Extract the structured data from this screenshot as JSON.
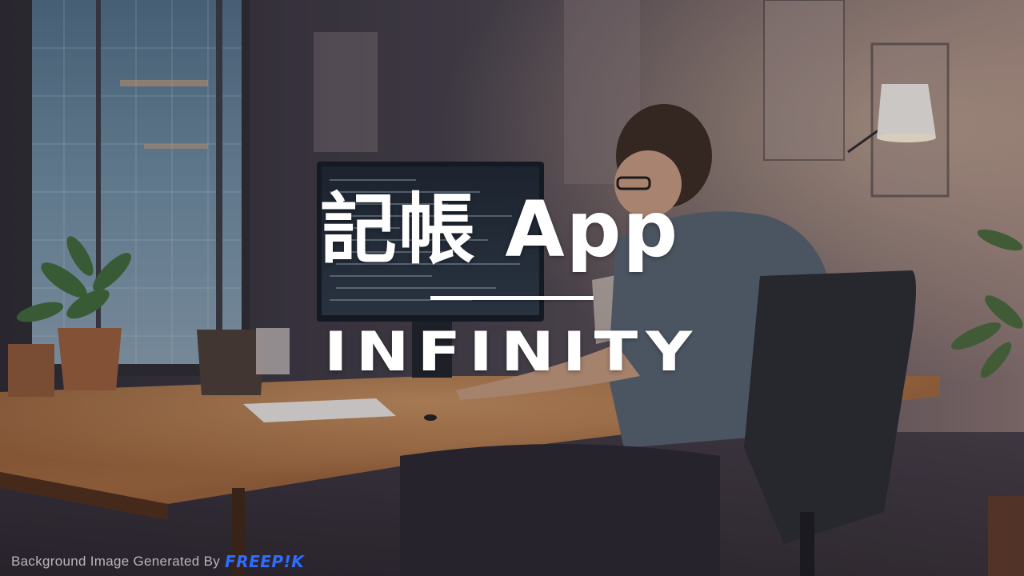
{
  "slide": {
    "title": "記帳 App",
    "subtitle": "INFINITY",
    "credit_text": "Background Image Generated  By",
    "credit_brand": "FREEP!K"
  },
  "colors": {
    "title": "#ffffff",
    "credit_text": "#b8b4bf",
    "credit_brand": "#2f6cff",
    "wall": "#3a3540",
    "desk": "#7a4a2c",
    "window_glow": "#7fa0b8",
    "lamp_light": "#f6e7cf"
  },
  "background": {
    "description_icon": "developer-at-desk-illustration"
  }
}
